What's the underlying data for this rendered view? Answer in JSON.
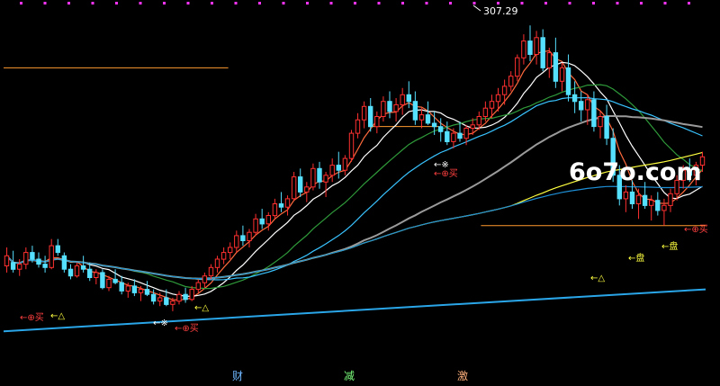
{
  "chart_data": {
    "type": "candlestick",
    "price_range": [
      116,
      316
    ],
    "bar_count": 152,
    "peak": {
      "bar": 102,
      "value": 307.29,
      "label": "307.29"
    },
    "candles": [
      [
        164,
        175,
        160,
        170
      ],
      [
        166,
        173,
        160,
        162
      ],
      [
        162,
        168,
        158,
        165
      ],
      [
        165,
        175,
        162,
        172
      ],
      [
        172,
        176,
        166,
        168
      ],
      [
        168,
        172,
        163,
        165
      ],
      [
        165,
        170,
        160,
        163
      ],
      [
        163,
        180,
        162,
        176
      ],
      [
        176,
        180,
        170,
        172
      ],
      [
        170,
        172,
        160,
        162
      ],
      [
        162,
        165,
        156,
        158
      ],
      [
        158,
        166,
        157,
        164
      ],
      [
        164,
        170,
        160,
        162
      ],
      [
        162,
        166,
        155,
        157
      ],
      [
        157,
        162,
        153,
        160
      ],
      [
        160,
        162,
        150,
        151
      ],
      [
        151,
        158,
        149,
        156
      ],
      [
        156,
        162,
        153,
        154
      ],
      [
        154,
        158,
        147,
        149
      ],
      [
        149,
        154,
        145,
        152
      ],
      [
        152,
        156,
        146,
        148
      ],
      [
        148,
        152,
        143,
        150
      ],
      [
        150,
        155,
        146,
        147
      ],
      [
        147,
        150,
        141,
        143
      ],
      [
        143,
        148,
        140,
        145
      ],
      [
        145,
        150,
        140,
        141
      ],
      [
        141,
        145,
        137,
        143
      ],
      [
        143,
        149,
        141,
        147
      ],
      [
        147,
        151,
        142,
        144
      ],
      [
        144,
        152,
        143,
        150
      ],
      [
        150,
        156,
        148,
        154
      ],
      [
        154,
        160,
        151,
        158
      ],
      [
        158,
        165,
        156,
        163
      ],
      [
        163,
        170,
        160,
        168
      ],
      [
        168,
        175,
        165,
        172
      ],
      [
        172,
        178,
        168,
        175
      ],
      [
        175,
        185,
        172,
        182
      ],
      [
        182,
        188,
        176,
        179
      ],
      [
        179,
        186,
        175,
        184
      ],
      [
        184,
        195,
        182,
        192
      ],
      [
        192,
        198,
        186,
        189
      ],
      [
        189,
        196,
        185,
        194
      ],
      [
        194,
        204,
        192,
        201
      ],
      [
        201,
        208,
        196,
        199
      ],
      [
        199,
        206,
        194,
        204
      ],
      [
        204,
        220,
        203,
        217
      ],
      [
        217,
        222,
        205,
        208
      ],
      [
        208,
        214,
        202,
        211
      ],
      [
        211,
        225,
        209,
        222
      ],
      [
        222,
        226,
        210,
        214
      ],
      [
        214,
        220,
        205,
        218
      ],
      [
        218,
        228,
        214,
        224
      ],
      [
        224,
        232,
        216,
        221
      ],
      [
        221,
        230,
        218,
        228
      ],
      [
        228,
        245,
        226,
        243
      ],
      [
        243,
        255,
        240,
        251
      ],
      [
        251,
        262,
        246,
        259
      ],
      [
        259,
        264,
        244,
        247
      ],
      [
        247,
        256,
        243,
        253
      ],
      [
        253,
        265,
        250,
        262
      ],
      [
        262,
        268,
        252,
        256
      ],
      [
        256,
        264,
        250,
        260
      ],
      [
        260,
        270,
        254,
        266
      ],
      [
        266,
        274,
        258,
        262
      ],
      [
        262,
        268,
        248,
        251
      ],
      [
        251,
        258,
        246,
        254
      ],
      [
        254,
        262,
        248,
        249
      ],
      [
        249,
        256,
        242,
        247
      ],
      [
        247,
        252,
        238,
        244
      ],
      [
        244,
        250,
        236,
        238
      ],
      [
        238,
        246,
        234,
        243
      ],
      [
        243,
        250,
        238,
        240
      ],
      [
        240,
        248,
        236,
        246
      ],
      [
        246,
        252,
        242,
        248
      ],
      [
        248,
        256,
        245,
        253
      ],
      [
        253,
        262,
        250,
        258
      ],
      [
        258,
        266,
        252,
        262
      ],
      [
        262,
        270,
        256,
        266
      ],
      [
        266,
        275,
        260,
        271
      ],
      [
        271,
        280,
        268,
        277
      ],
      [
        277,
        290,
        274,
        288
      ],
      [
        288,
        302,
        284,
        298
      ],
      [
        298,
        307.29,
        286,
        290
      ],
      [
        290,
        304,
        284,
        300
      ],
      [
        300,
        305,
        280,
        282
      ],
      [
        282,
        294,
        276,
        291
      ],
      [
        291,
        300,
        270,
        274
      ],
      [
        274,
        285,
        268,
        282
      ],
      [
        282,
        290,
        262,
        266
      ],
      [
        266,
        274,
        255,
        262
      ],
      [
        262,
        268,
        250,
        257
      ],
      [
        257,
        266,
        248,
        263
      ],
      [
        263,
        268,
        244,
        247
      ],
      [
        247,
        256,
        240,
        253
      ],
      [
        253,
        260,
        236,
        240
      ],
      [
        240,
        246,
        214,
        218
      ],
      [
        218,
        224,
        200,
        204
      ],
      [
        204,
        212,
        196,
        208
      ],
      [
        208,
        215,
        198,
        201
      ],
      [
        201,
        210,
        192,
        206
      ],
      [
        206,
        214,
        198,
        200
      ],
      [
        200,
        206,
        191,
        203
      ],
      [
        203,
        208,
        194,
        197
      ],
      [
        197,
        204,
        188,
        200
      ],
      [
        200,
        210,
        196,
        207
      ],
      [
        207,
        218,
        203,
        215
      ],
      [
        215,
        224,
        210,
        221
      ],
      [
        221,
        228,
        214,
        218
      ],
      [
        218,
        226,
        212,
        224
      ],
      [
        224,
        232,
        220,
        229
      ]
    ],
    "overlay_lines": [
      {
        "name": "",
        "color": "#ff6a3d"
      },
      {
        "name": "",
        "color": "#ffffff"
      },
      {
        "name": "",
        "color": "#2f9a3a"
      },
      {
        "name": "",
        "color": "#39c3ff"
      },
      {
        "name": "",
        "color": "#9a9a9a"
      },
      {
        "name": "",
        "color": "#ffff40"
      },
      {
        "name": "",
        "color": "#1e8fd6"
      },
      {
        "name": "",
        "color": "#3aa0ff"
      },
      {
        "name": "",
        "color": "#ff9a2e"
      }
    ],
    "resistance_levels": [
      {
        "value": 282,
        "color": "#ff9a2e"
      },
      {
        "value": 247,
        "color": "#ff9a2e"
      },
      {
        "value": 188,
        "color": "#ff9a2e"
      }
    ],
    "signals": [
      {
        "text": "←⊕买",
        "color": "#ff4040"
      },
      {
        "text": "←△",
        "color": "#ffff40"
      },
      {
        "text": "←※",
        "color": "#ffffff"
      },
      {
        "text": "←⊕买",
        "color": "#ff4040"
      },
      {
        "text": "←△",
        "color": "#ffff40"
      },
      {
        "text": "←※",
        "color": "#ffffff"
      },
      {
        "text": "←⊕买",
        "color": "#ff4040"
      },
      {
        "text": "←△",
        "color": "#ffff40"
      },
      {
        "text": "←盘",
        "color": "#ffff40"
      },
      {
        "text": "←⊕买",
        "color": "#ff4040"
      },
      {
        "text": "←盘",
        "color": "#ffff40"
      }
    ],
    "bottom_markers": [
      {
        "text": "财",
        "color": "#6fb7ff"
      },
      {
        "text": "减",
        "color": "#7cff7c"
      },
      {
        "text": "激",
        "color": "#ffb07c"
      }
    ],
    "top_markers_color": "#ff33ff",
    "colors": {
      "up": "#ff3030",
      "down": "#56e0ff",
      "background": "#000000"
    }
  },
  "watermark": {
    "text": "6o7o.com"
  }
}
